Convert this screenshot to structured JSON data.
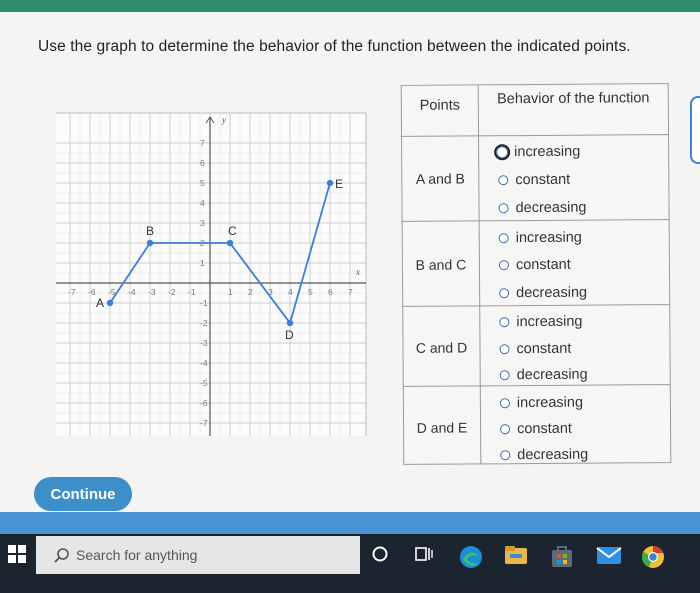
{
  "instruction": "Use the graph to determine the behavior of the function between the indicated points.",
  "graph": {
    "x_ticks": [
      "-7",
      "-6",
      "-5",
      "-4",
      "-3",
      "-2",
      "-1",
      "1",
      "2",
      "3",
      "4",
      "5",
      "6",
      "7"
    ],
    "y_ticks": [
      "7",
      "6",
      "5",
      "4",
      "3",
      "2",
      "1",
      "-1",
      "-2",
      "-3",
      "-4",
      "-5",
      "-6",
      "-7"
    ],
    "x_axis_label": "x",
    "y_axis_label": "y",
    "points": [
      {
        "label": "A",
        "x": -5,
        "y": -1
      },
      {
        "label": "B",
        "x": -3,
        "y": 2
      },
      {
        "label": "C",
        "x": 1,
        "y": 2
      },
      {
        "label": "D",
        "x": 4,
        "y": -2
      },
      {
        "label": "E",
        "x": 6,
        "y": 5
      }
    ],
    "line_color": "#3b7fd4"
  },
  "table": {
    "header_points": "Points",
    "header_behavior": "Behavior of the function",
    "rows": [
      {
        "label": "A and B",
        "options": [
          "increasing",
          "constant",
          "decreasing"
        ]
      },
      {
        "label": "B and C",
        "options": [
          "increasing",
          "constant",
          "decreasing"
        ]
      },
      {
        "label": "C and D",
        "options": [
          "increasing",
          "constant",
          "decreasing"
        ]
      },
      {
        "label": "D and E",
        "options": [
          "increasing",
          "constant",
          "decreasing"
        ]
      }
    ]
  },
  "continue_label": "Continue",
  "taskbar": {
    "search_placeholder": "Search for anything"
  }
}
